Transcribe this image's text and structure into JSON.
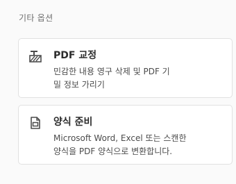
{
  "section": {
    "title": "기타 옵션"
  },
  "cards": [
    {
      "icon": "redact-icon",
      "title": "PDF 교정",
      "desc_line1": "민감한 내용 영구 삭제 및 PDF 기",
      "desc_line2": "밀 정보 가리기"
    },
    {
      "icon": "prepare-form-icon",
      "title": "양식 준비",
      "desc_line1": "Microsoft Word, Excel 또는 스캔한",
      "desc_line2": "양식을 PDF 양식으로 변환합니다."
    }
  ],
  "colors": {
    "background": "#fafafa",
    "card": "#ffffff",
    "border": "#e1e1e1",
    "text": "#2c2c2c",
    "muted": "#6e6e6e"
  }
}
